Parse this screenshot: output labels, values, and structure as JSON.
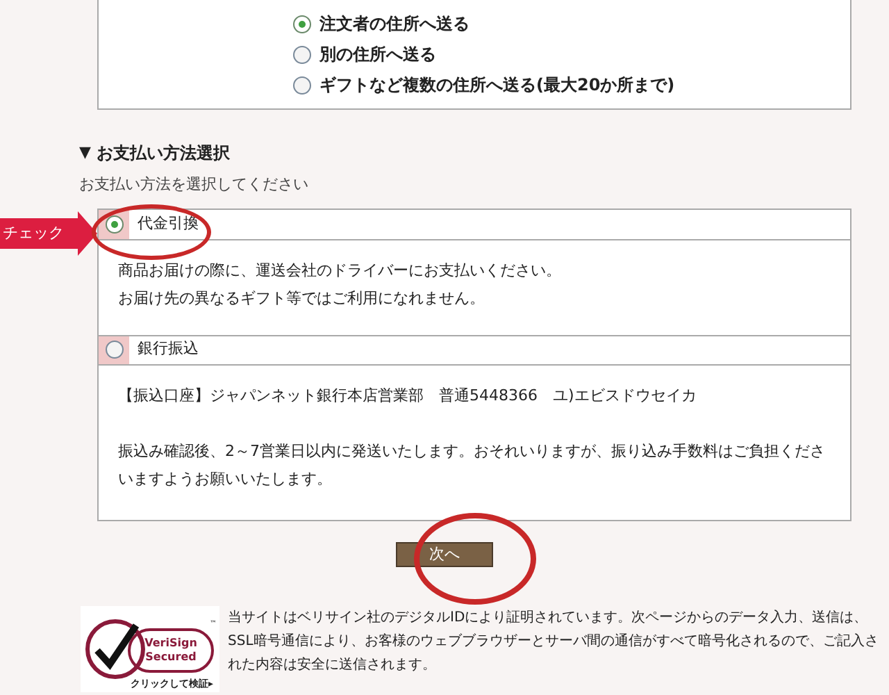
{
  "shipping": {
    "options": [
      {
        "label": "注文者の住所へ送る",
        "selected": true
      },
      {
        "label": "別の住所へ送る",
        "selected": false
      },
      {
        "label": "ギフトなど複数の住所へ送る(最大20か所まで)",
        "selected": false
      }
    ]
  },
  "payment": {
    "heading_marker": "▼",
    "heading": "お支払い方法選択",
    "instruction": "お支払い方法を選択してください",
    "methods": [
      {
        "label": "代金引換",
        "selected": true,
        "paragraphs": [
          [
            "商品お届けの際に、運送会社のドライバーにお支払いください。",
            "お届け先の異なるギフト等ではご利用になれません。"
          ]
        ]
      },
      {
        "label": "銀行振込",
        "selected": false,
        "paragraphs": [
          [
            "【振込口座】ジャパンネット銀行本店営業部　普通5448366　ユ)エビスドウセイカ"
          ],
          [
            "振込み確認後、2～7営業日以内に発送いたします。おそれいりますが、振り込み手数料はご負担くださいますようお願いいたします。"
          ]
        ]
      }
    ]
  },
  "next_button": "次へ",
  "annotation": {
    "label": "チェック"
  },
  "security": {
    "badge_name": "VeriSign",
    "badge_secured": "Secured",
    "badge_tm": "™",
    "badge_link": "クリックして検証▸",
    "text": "当サイトはベリサイン社のデジタルIDにより証明されています。次ページからのデータ入力、送信は、SSL暗号通信により、お客様のウェブブラウザーとサーバ間の通信がすべて暗号化されるので、ご記入された内容は安全に送信されます。"
  }
}
